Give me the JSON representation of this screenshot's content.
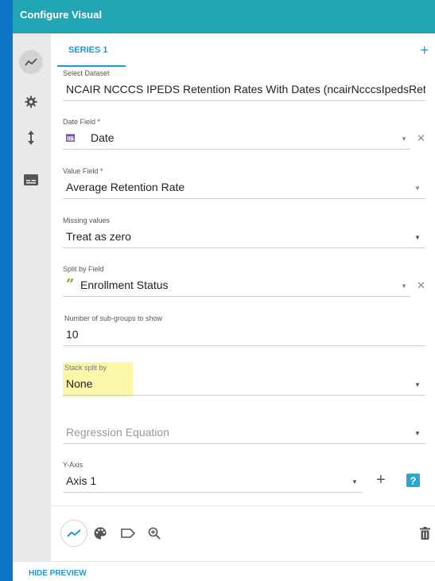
{
  "header": {
    "title": "Configure Visual"
  },
  "sidebar": {
    "items": [
      {
        "icon": "line-chart-icon"
      },
      {
        "icon": "gear-icon"
      },
      {
        "icon": "vertical-arrows-icon"
      },
      {
        "icon": "subtitles-icon"
      }
    ]
  },
  "tabs": [
    {
      "label": "SERIES 1"
    }
  ],
  "add_series": "+",
  "fields": {
    "dataset": {
      "label": "Select Dataset",
      "value": "NCAIR NCCCS IPEDS Retention Rates With Dates (ncairNcccsIpedsRete"
    },
    "date_field": {
      "label": "Date Field *",
      "value": "Date",
      "icon": "calendar-icon"
    },
    "value_field": {
      "label": "Value Field *",
      "value": "Average Retention Rate"
    },
    "missing_values": {
      "label": "Missing values",
      "value": "Treat as zero"
    },
    "split_by": {
      "label": "Split by Field",
      "value": "Enrollment Status",
      "icon": "quote-icon"
    },
    "subgroups": {
      "label": "Number of sub-groups to show",
      "value": "10"
    },
    "stack_split": {
      "label": "Stack split by",
      "value": "None"
    },
    "regression": {
      "placeholder": "Regression Equation"
    },
    "y_axis": {
      "label": "Y-Axis",
      "value": "Axis 1"
    }
  },
  "footer": {
    "icons": [
      "line-chart-icon",
      "palette-icon",
      "label-icon",
      "zoom-in-icon",
      "trash-icon"
    ]
  },
  "hide_preview": "HIDE PREVIEW",
  "colors": {
    "header": "#21a6b6",
    "accent": "#1a9bd6",
    "frame": "#0b74c4",
    "highlight": "#fbf6a8"
  }
}
